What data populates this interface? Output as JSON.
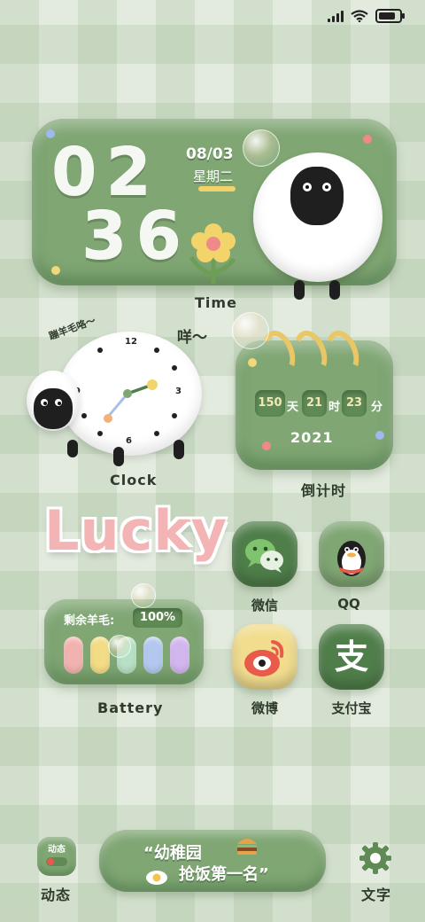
{
  "time_widget": {
    "hour": "02",
    "minute": "36",
    "date": "08/03",
    "weekday": "星期二",
    "label": "Time"
  },
  "clock_widget": {
    "caption_left": "蹦羊毛咯～",
    "caption_right": "咩～",
    "numbers": {
      "twelve": "12",
      "three": "3",
      "six": "6",
      "nine": "9"
    },
    "label": "Clock"
  },
  "countdown_widget": {
    "days": "150",
    "days_unit": "天",
    "hours": "21",
    "hours_unit": "时",
    "minutes": "23",
    "minutes_unit": "分",
    "year": "2021",
    "label": "倒计时"
  },
  "lucky_widget": {
    "text": "Lucky"
  },
  "battery_widget": {
    "title": "剩余羊毛:",
    "percent": "100%",
    "level": 1.0,
    "label": "Battery",
    "bar_colors": [
      "#f2b3b0",
      "#f3dc86",
      "#b7e0c4",
      "#b3c8ee",
      "#d2b6ee"
    ]
  },
  "apps": [
    {
      "label": "微信",
      "icon": "wechat-icon",
      "color": "#4f7e4a"
    },
    {
      "label": "QQ",
      "icon": "qq-penguin-icon",
      "color": "#7fa673"
    },
    {
      "label": "微博",
      "icon": "weibo-icon",
      "color": "#f2dd8e"
    },
    {
      "label": "支付宝",
      "icon": "alipay-icon",
      "color": "#4f7e4a"
    }
  ],
  "alipay_glyph": "支",
  "bottom_bar": {
    "left_button_text": "动态",
    "left_label": "动态",
    "quote_line1": "“幼稚园",
    "quote_line2": "抢饭第一名”",
    "right_label": "文字"
  },
  "colors": {
    "widget_green": "#7fa673",
    "dark_green": "#4f7e4a",
    "accent_yellow": "#e9c766"
  }
}
